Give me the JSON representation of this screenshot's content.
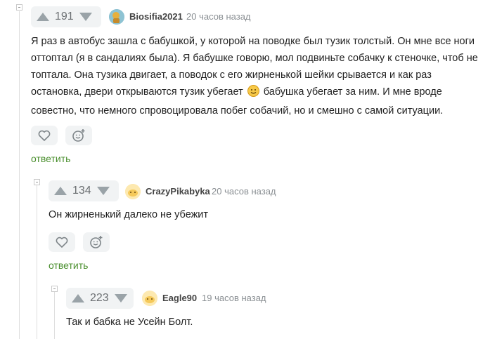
{
  "comments": [
    {
      "rating": "191",
      "username": "Biosifia2021",
      "time": "20 часов назад",
      "text": [
        "Я раз в автобус зашла с бабушкой, у которой на поводке был тузик толстый. Он мне все ноги",
        "оттоптал (я в сандалиях была). Я бабушке говорю, мол подвиньте собачку к стеночке, чтоб не",
        "топтала. Она тузика двигает, а поводок с его жирненькой шейки срывается и как раз",
        "остановка, двери открываются тузик убегает",
        "бабушка убегает за ним. И мне вроде",
        "совестно, что немного спровоцировала побег собачий, но и смешно с самой ситуации."
      ],
      "reply_label": "ответить",
      "avatar_color": "#e7b03c"
    },
    {
      "rating": "134",
      "username": "CrazyPikabyka",
      "time": "20 часов назад",
      "text": [
        "Он жирненький далеко не убежит"
      ],
      "reply_label": "ответить",
      "avatar_color": "#f6d67c"
    },
    {
      "rating": "223",
      "username": "Eagle90",
      "time": "19 часов назад",
      "text": [
        "Так и бабка не Усейн Болт."
      ],
      "avatar_color": "#f6d67c"
    }
  ],
  "icons": {
    "upvote": "arrow-up-icon",
    "downvote": "arrow-down-icon",
    "like": "heart-icon",
    "react": "emoji-add-icon",
    "inline_emoji": "smiley-icon",
    "collapse": "collapse-icon"
  },
  "colors": {
    "reply": "#4a8f2e",
    "badge_bg": "#f1f3f4",
    "muted": "#8a8f93"
  }
}
